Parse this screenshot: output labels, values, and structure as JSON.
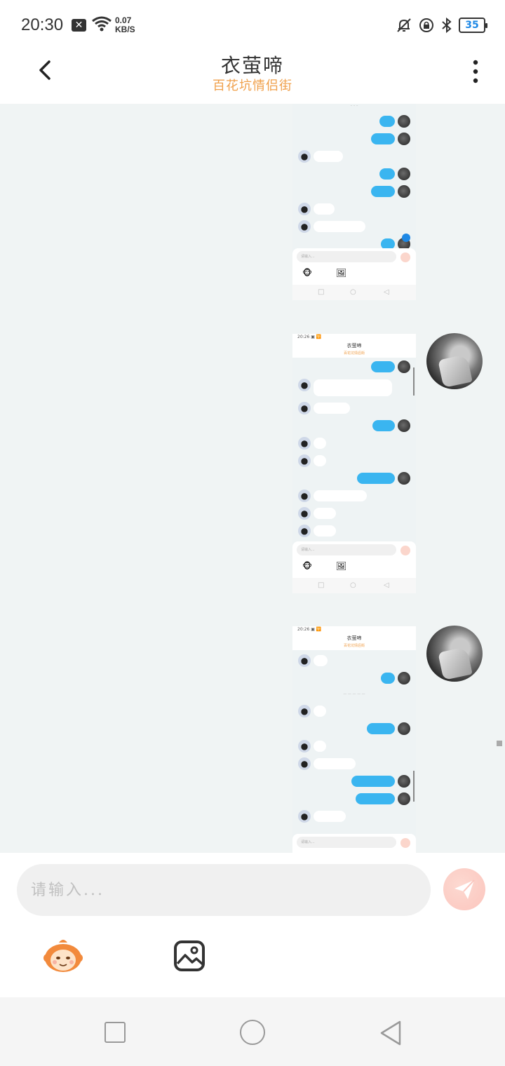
{
  "status_bar": {
    "time": "20:30",
    "net_speed_value": "0.07",
    "net_speed_unit": "KB/S",
    "battery": "35",
    "icons": [
      "close-notification-icon",
      "wifi-icon",
      "mute-bell-icon",
      "rotation-lock-icon",
      "bluetooth-icon",
      "battery-icon"
    ]
  },
  "header": {
    "title": "衣萤啼",
    "subtitle": "百花坑情侣街"
  },
  "screenshots": [
    {
      "status": "",
      "header_title": ""
    },
    {
      "status": "20:26 ▣ 🛜",
      "header_title": "衣萤啼",
      "header_sub": "百花坑情侣街"
    },
    {
      "status": "20:26 ▣ 🛜",
      "header_title": "衣萤啼",
      "header_sub": "百花坑情侣街",
      "divider": "— — — — —"
    }
  ],
  "composer": {
    "placeholder": "请输入...",
    "send_label": "send",
    "tools": [
      "emoji-icon",
      "image-icon"
    ]
  },
  "nav": [
    "recents",
    "home",
    "back"
  ],
  "colors": {
    "accent": "#f0a04b",
    "bubble_out": "#3ab5f0",
    "chat_bg": "#f0f4f4",
    "send_btn": "#fbc5bd"
  }
}
